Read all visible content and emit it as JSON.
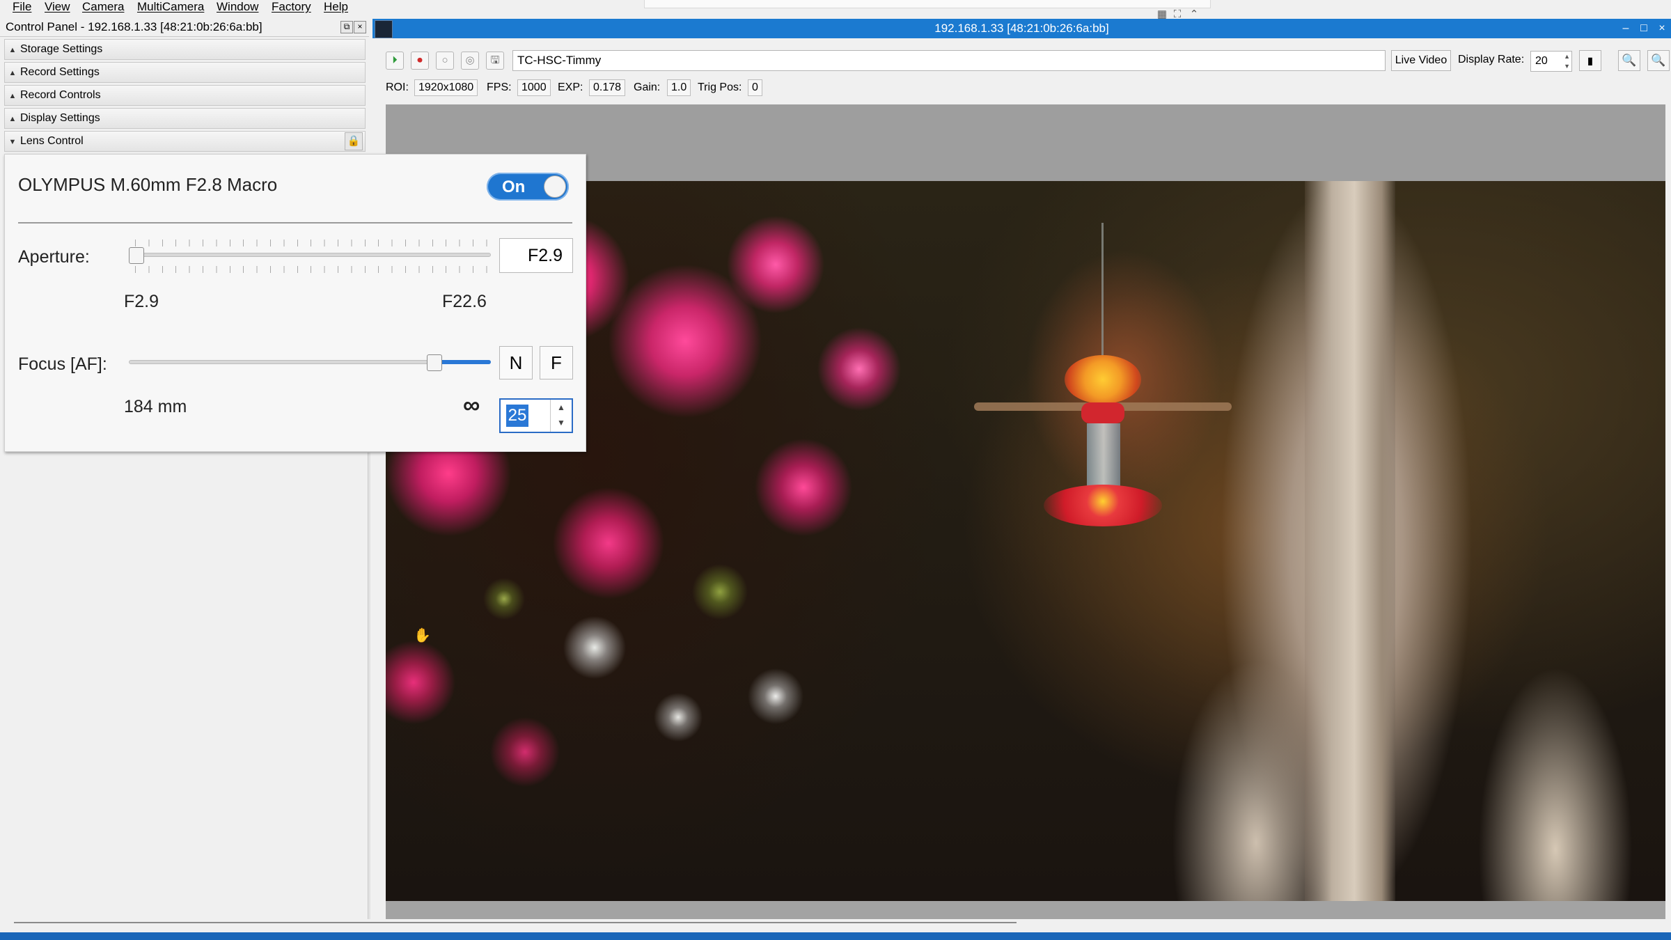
{
  "menu": [
    "File",
    "View",
    "Camera",
    "MultiCamera",
    "Window",
    "Factory",
    "Help"
  ],
  "control_panel": {
    "title": "Control Panel - 192.168.1.33 [48:21:0b:26:6a:bb]",
    "sections": [
      "Storage Settings",
      "Record Settings",
      "Record Controls",
      "Display Settings",
      "Lens Control"
    ]
  },
  "lens": {
    "name": "OLYMPUS M.60mm F2.8 Macro",
    "toggle_label": "On",
    "aperture": {
      "label": "Aperture:",
      "value": "F2.9",
      "min_label": "F2.9",
      "max_label": "F22.6",
      "position_fraction": 0.0
    },
    "focus": {
      "label": "Focus [AF]:",
      "near_button": "N",
      "far_button": "F",
      "distance": "184 mm",
      "infinity_symbol": "∞",
      "step": "25",
      "position_fraction": 0.86
    }
  },
  "camera_window": {
    "title": "192.168.1.33 [48:21:0b:26:6a:bb]",
    "camera_name": "TC-HSC-Timmy",
    "live_video": "Live Video",
    "display_rate_label": "Display Rate:",
    "display_rate": "20",
    "stats": [
      {
        "label": "ROI:",
        "value": "1920x1080"
      },
      {
        "label": "FPS:",
        "value": "1000"
      },
      {
        "label": "EXP:",
        "value": "0.178"
      },
      {
        "label": "Gain:",
        "value": "1.0"
      },
      {
        "label": "Trig Pos:",
        "value": "0"
      }
    ]
  },
  "colors": {
    "accent": "#1b7ad0",
    "toggle_on": "#1f76d0",
    "slider_fill": "#2a78d6"
  }
}
